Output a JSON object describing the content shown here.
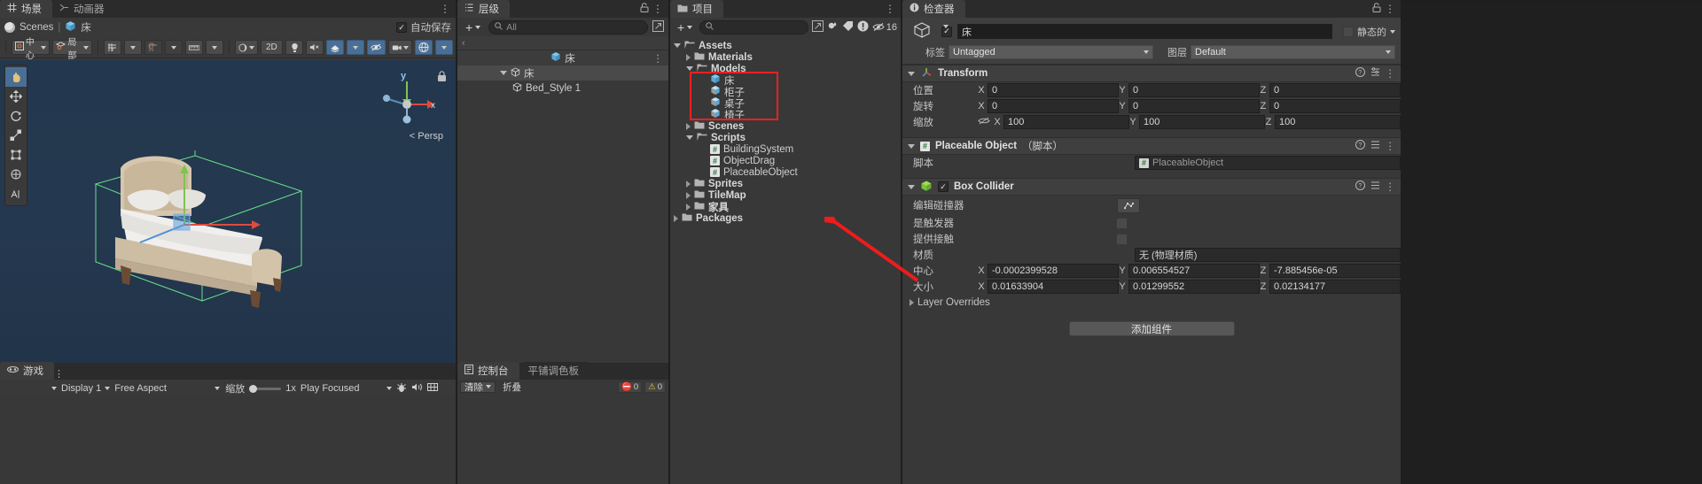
{
  "scene": {
    "tabs": [
      {
        "label": "场景",
        "icon": "grid-icon",
        "active": true
      },
      {
        "label": "动画器",
        "icon": "animator-icon",
        "active": false
      }
    ],
    "autosave_label": "自动保存",
    "breadcrumb": [
      "Scenes",
      "床"
    ],
    "tools": {
      "pivot": "中心",
      "space": "局部",
      "twod": "2D",
      "persp_label": "< Persp"
    },
    "left_tools": [
      "hand-icon",
      "move-icon",
      "rotate-icon",
      "scale-icon",
      "rect-icon",
      "transform-icon",
      "custom-icon"
    ],
    "gizmo_axis": "y"
  },
  "game": {
    "tab_label": "游戏",
    "display": "Display 1",
    "aspect": "Free Aspect",
    "zoom_label": "缩放",
    "zoom_value": "1x",
    "play_mode": "Play Focused"
  },
  "hierarchy": {
    "tab_label": "层级",
    "search_placeholder": "All",
    "root_label": "床",
    "items": [
      {
        "label": "床",
        "depth": 0,
        "expanded": true,
        "selected": false
      },
      {
        "label": "Bed_Style 1",
        "depth": 1,
        "expanded": false,
        "selected": false
      }
    ]
  },
  "project": {
    "tab_label": "项目",
    "badge_count": "16",
    "tree": [
      {
        "label": "Assets",
        "depth": 0,
        "icon": "folder-open-icon",
        "arrow": "down",
        "bold": true
      },
      {
        "label": "Materials",
        "depth": 1,
        "icon": "folder-icon",
        "arrow": "right",
        "bold": true
      },
      {
        "label": "Models",
        "depth": 1,
        "icon": "folder-open-icon",
        "arrow": "down",
        "bold": true
      },
      {
        "label": "床",
        "depth": 2,
        "icon": "prefab-icon",
        "arrow": "none",
        "bold": false
      },
      {
        "label": "柜子",
        "depth": 2,
        "icon": "model-icon",
        "arrow": "none",
        "bold": false
      },
      {
        "label": "桌子",
        "depth": 2,
        "icon": "model-icon",
        "arrow": "none",
        "bold": false
      },
      {
        "label": "椅子",
        "depth": 2,
        "icon": "model-icon",
        "arrow": "none",
        "bold": false
      },
      {
        "label": "Scenes",
        "depth": 1,
        "icon": "folder-icon",
        "arrow": "right",
        "bold": true
      },
      {
        "label": "Scripts",
        "depth": 1,
        "icon": "folder-open-icon",
        "arrow": "down",
        "bold": true
      },
      {
        "label": "BuildingSystem",
        "depth": 2,
        "icon": "cs-script-icon",
        "arrow": "none",
        "bold": false
      },
      {
        "label": "ObjectDrag",
        "depth": 2,
        "icon": "cs-script-icon",
        "arrow": "none",
        "bold": false
      },
      {
        "label": "PlaceableObject",
        "depth": 2,
        "icon": "cs-script-icon",
        "arrow": "none",
        "bold": false
      },
      {
        "label": "Sprites",
        "depth": 1,
        "icon": "folder-icon",
        "arrow": "right",
        "bold": true
      },
      {
        "label": "TileMap",
        "depth": 1,
        "icon": "folder-icon",
        "arrow": "right",
        "bold": true
      },
      {
        "label": "家具",
        "depth": 1,
        "icon": "folder-icon",
        "arrow": "right",
        "bold": true
      },
      {
        "label": "Packages",
        "depth": 0,
        "icon": "folder-icon",
        "arrow": "right",
        "bold": true
      }
    ],
    "highlight_color": "#ef2020"
  },
  "inspector": {
    "tab_label": "检查器",
    "object_name": "床",
    "static_label": "静态的",
    "tag_label": "标签",
    "tag_value": "Untagged",
    "layer_label": "图层",
    "layer_value": "Default",
    "transform": {
      "title": "Transform",
      "position_label": "位置",
      "position": {
        "x": "0",
        "y": "0",
        "z": "0"
      },
      "rotation_label": "旋转",
      "rotation": {
        "x": "0",
        "y": "0",
        "z": "0"
      },
      "scale_label": "缩放",
      "scale": {
        "x": "100",
        "y": "100",
        "z": "100"
      }
    },
    "placeable": {
      "title": "Placeable Object",
      "suffix": "（脚本）",
      "script_label": "脚本",
      "script_value": "PlaceableObject"
    },
    "collider": {
      "title": "Box Collider",
      "edit_label": "编辑碰撞器",
      "trigger_label": "是触发器",
      "contacts_label": "提供接触",
      "material_label": "材质",
      "material_value": "无 (物理材质)",
      "center_label": "中心",
      "center": {
        "x": "-0.0002399528",
        "y": "0.006554527",
        "z": "-7.885456e-05"
      },
      "size_label": "大小",
      "size": {
        "x": "0.01633904",
        "y": "0.01299552",
        "z": "0.02134177"
      },
      "layer_overrides_label": "Layer Overrides"
    },
    "add_component_label": "添加组件"
  },
  "console": {
    "tabs": [
      {
        "label": "控制台",
        "active": true
      },
      {
        "label": "平铺调色板",
        "active": false
      }
    ],
    "clear_label": "清除",
    "collapse_label": "折叠",
    "counts": {
      "errors": "0",
      "warnings": "0"
    }
  }
}
